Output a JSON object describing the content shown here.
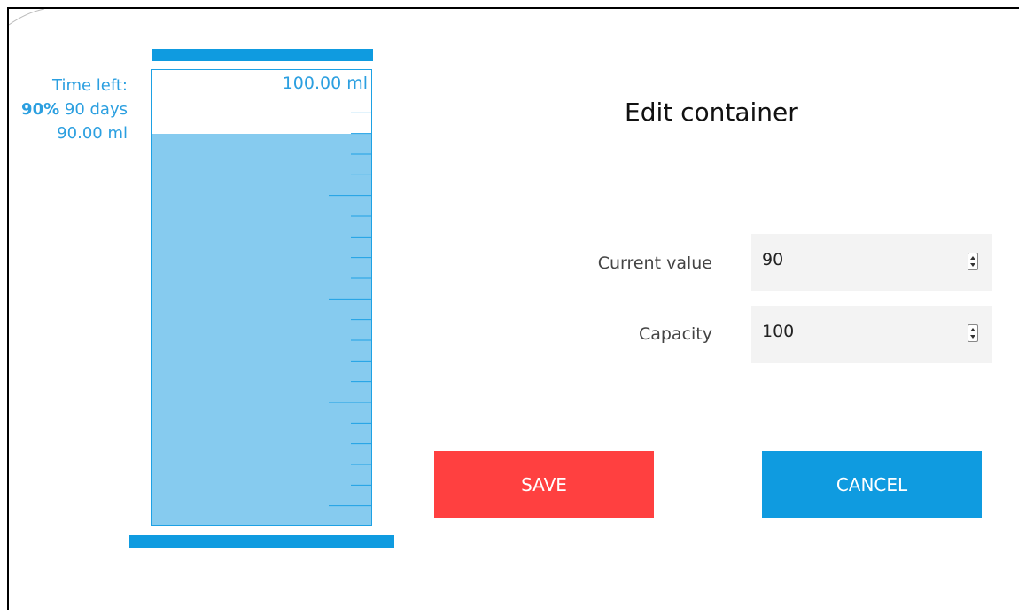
{
  "container": {
    "capacity_label": "100.00 ml",
    "fill_fraction": 0.9,
    "time_left_label": "Time left:",
    "percent": "90%",
    "days": "90 days",
    "volume": "90.00 ml"
  },
  "form": {
    "title": "Edit container",
    "current_value_label": "Current value",
    "current_value": "90",
    "capacity_label": "Capacity",
    "capacity_value": "100"
  },
  "buttons": {
    "save": "SAVE",
    "cancel": "CANCEL"
  },
  "colors": {
    "accent_blue": "#0f9be0",
    "fill_blue": "#86cbef",
    "save_red": "#ff4040"
  }
}
